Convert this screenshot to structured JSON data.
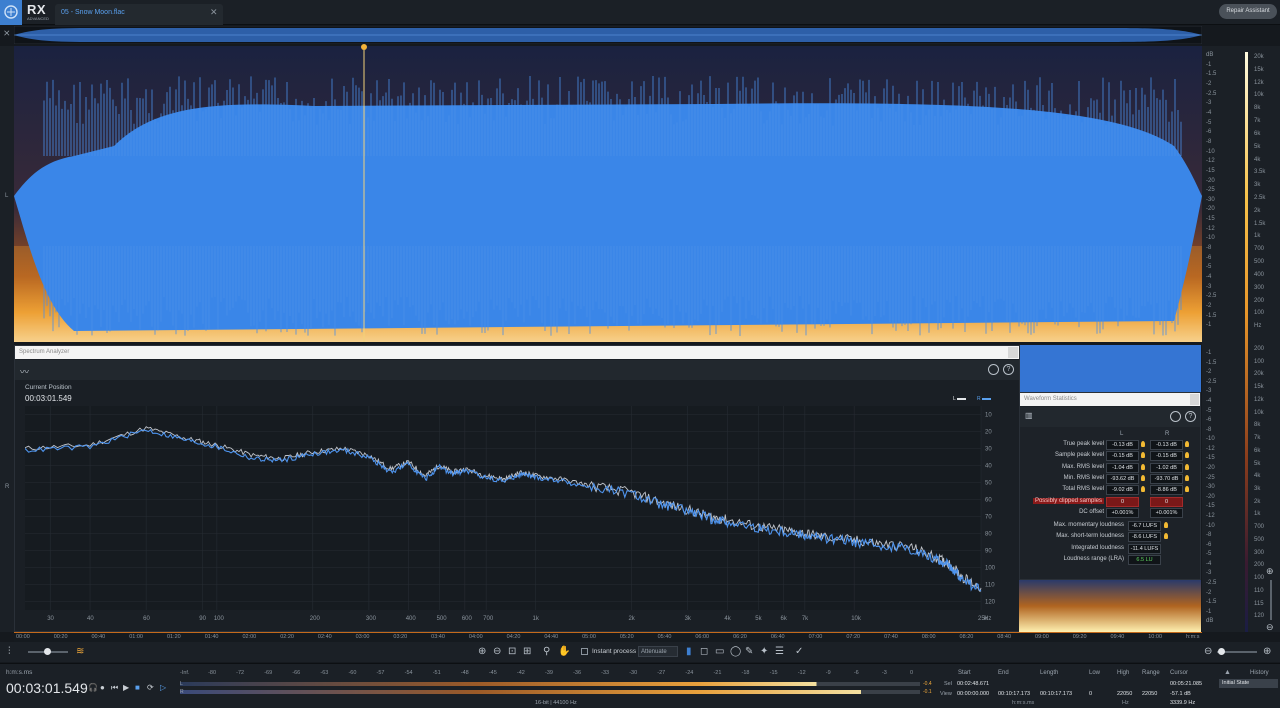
{
  "app": {
    "logo": "RX",
    "logo_sub": "ADVANCED",
    "file_tab": "05 - Snow Moon.flac",
    "repair_assistant": "Repair Assistant"
  },
  "channels": {
    "left": "L",
    "right": "R"
  },
  "db_scale": [
    "dB",
    "-1",
    "-1.5",
    "-2",
    "-2.5",
    "-3",
    "-4",
    "-5",
    "-6",
    "-8",
    "-10",
    "-12",
    "-15",
    "-20",
    "-25",
    "-30",
    "-20",
    "-15",
    "-12",
    "-10",
    "-8",
    "-6",
    "-5",
    "-4",
    "-3",
    "-2.5",
    "-2",
    "-1.5",
    "-1"
  ],
  "hz_scale": [
    "20k",
    "15k",
    "12k",
    "10k",
    "8k",
    "7k",
    "6k",
    "5k",
    "4k",
    "3.5k",
    "3k",
    "2.5k",
    "2k",
    "1.5k",
    "1k",
    "700",
    "500",
    "400",
    "300",
    "200",
    "100",
    "Hz"
  ],
  "db_scale_lower": [
    "-1",
    "-1.5",
    "-2",
    "-2.5",
    "-3",
    "-4",
    "-5",
    "-6",
    "-8",
    "-10",
    "-12",
    "-15",
    "-20",
    "-25",
    "-30",
    "-20",
    "-15",
    "-12",
    "-10",
    "-8",
    "-6",
    "-5",
    "-4",
    "-3",
    "-2.5",
    "-2",
    "-1.5",
    "-1",
    "dB"
  ],
  "hz_scale_lower": [
    "200",
    "100",
    "20k",
    "15k",
    "12k",
    "10k",
    "8k",
    "7k",
    "6k",
    "5k",
    "4k",
    "3k",
    "2k",
    "1k",
    "700",
    "500",
    "300",
    "200",
    "100",
    "110",
    "115",
    "120"
  ],
  "spectrum_analyzer": {
    "title": "Spectrum Analyzer",
    "current_position_label": "Current Position",
    "current_position_time": "00:03:01.549",
    "legend_l": "L",
    "legend_r": "R",
    "help": "?"
  },
  "chart_data": {
    "type": "line",
    "title": "",
    "xlabel": "Hz",
    "ylabel": "dB",
    "x_scale": "log",
    "xlim": [
      25,
      25000
    ],
    "ylim": [
      -125,
      -5
    ],
    "x_tick_labels": [
      "30",
      "40",
      "60",
      "90",
      "100",
      "200",
      "300",
      "400",
      "500",
      "600",
      "700",
      "1k",
      "2k",
      "3k",
      "4k",
      "5k",
      "6k",
      "7k",
      "10k",
      "25k",
      "Hz"
    ],
    "y_tick_labels": [
      "10",
      "20",
      "30",
      "40",
      "50",
      "60",
      "70",
      "80",
      "90",
      "100",
      "110",
      "120"
    ],
    "grid": true,
    "series": [
      {
        "name": "L",
        "x": [
          25,
          40,
          60,
          80,
          100,
          130,
          160,
          200,
          250,
          300,
          350,
          400,
          450,
          500,
          550,
          600,
          700,
          800,
          900,
          1000,
          1200,
          1500,
          2000,
          2500,
          3000,
          3500,
          4000,
          5000,
          6000,
          7000,
          8000,
          10000,
          12000,
          15000,
          18000,
          20000,
          22000,
          25000
        ],
        "y": [
          -30,
          -28,
          -18,
          -24,
          -28,
          -34,
          -36,
          -32,
          -30,
          -34,
          -42,
          -38,
          -46,
          -40,
          -44,
          -42,
          -46,
          -48,
          -44,
          -46,
          -48,
          -52,
          -56,
          -62,
          -66,
          -70,
          -72,
          -76,
          -78,
          -80,
          -82,
          -84,
          -86,
          -88,
          -94,
          -98,
          -106,
          -112
        ]
      },
      {
        "name": "R",
        "x": [
          25,
          40,
          60,
          80,
          100,
          130,
          160,
          200,
          250,
          300,
          350,
          400,
          450,
          500,
          550,
          600,
          700,
          800,
          900,
          1000,
          1200,
          1500,
          2000,
          2500,
          3000,
          3500,
          4000,
          5000,
          6000,
          7000,
          8000,
          10000,
          12000,
          15000,
          18000,
          20000,
          22000,
          25000
        ],
        "y": [
          -31,
          -29,
          -19,
          -25,
          -29,
          -36,
          -37,
          -33,
          -31,
          -35,
          -44,
          -39,
          -48,
          -41,
          -45,
          -43,
          -47,
          -49,
          -45,
          -47,
          -49,
          -53,
          -57,
          -63,
          -67,
          -71,
          -73,
          -77,
          -79,
          -81,
          -83,
          -85,
          -87,
          -89,
          -95,
          -99,
          -107,
          -114
        ]
      }
    ]
  },
  "waveform_statistics": {
    "title": "Waveform Statistics",
    "col_l": "L",
    "col_r": "R",
    "help": "?",
    "rows": [
      {
        "label": "True peak level",
        "l": "-0.13 dB",
        "r": "-0.13 dB"
      },
      {
        "label": "Sample peak level",
        "l": "-0.15 dB",
        "r": "-0.15 dB"
      },
      {
        "label": "Max. RMS level",
        "l": "-1.04 dB",
        "r": "-1.02 dB"
      },
      {
        "label": "Min. RMS level",
        "l": "-93.62 dB",
        "r": "-93.70 dB"
      },
      {
        "label": "Total RMS level",
        "l": "-9.02 dB",
        "r": "-8.86 dB"
      },
      {
        "label": "Possibly clipped samples",
        "l": "0",
        "r": "0"
      },
      {
        "label": "DC offset",
        "l": "+0.001%",
        "r": "+0.001%"
      }
    ],
    "loudness": [
      {
        "label": "Max. momentary loudness",
        "value": "-6.7 LUFS"
      },
      {
        "label": "Max. short-term loudness",
        "value": "-8.6 LUFS"
      },
      {
        "label": "Integrated loudness",
        "value": "-11.4 LUFS"
      },
      {
        "label": "Loudness range (LRA)",
        "value": "6.5 LU"
      }
    ]
  },
  "time_ruler": [
    "00:00",
    "00:20",
    "00:40",
    "01:00",
    "01:20",
    "01:40",
    "02:00",
    "02:20",
    "02:40",
    "03:00",
    "03:20",
    "03:40",
    "04:00",
    "04:20",
    "04:40",
    "05:00",
    "05:20",
    "05:40",
    "06:00",
    "06:20",
    "06:40",
    "07:00",
    "07:20",
    "07:40",
    "08:00",
    "08:20",
    "08:40",
    "09:00",
    "09:20",
    "09:40",
    "10:00",
    "h:m:s"
  ],
  "tools": {
    "instant_process": "Instant process",
    "attenuate": "Attenuate"
  },
  "transport": {
    "format": "h:m:s.ms",
    "time": "00:03:01.549"
  },
  "meter": {
    "ticks": [
      "-Inf.",
      "-80",
      "-72",
      "-69",
      "-66",
      "-63",
      "-60",
      "-57",
      "-54",
      "-51",
      "-48",
      "-45",
      "-42",
      "-39",
      "-36",
      "-33",
      "-30",
      "-27",
      "-24",
      "-21",
      "-18",
      "-15",
      "-12",
      "-9",
      "-6",
      "-3",
      "0"
    ],
    "peak_l": "-0.4",
    "peak_r": "-0.1",
    "l": "L",
    "r": "R",
    "format": "16-bit | 44100 Hz"
  },
  "selection": {
    "start_h": "Start",
    "end_h": "End",
    "length_h": "Length",
    "low_h": "Low",
    "high_h": "High",
    "range_h": "Range",
    "cursor_h": "Cursor",
    "sel_label": "Sel",
    "view_label": "View",
    "sel_start": "00:02:48.671",
    "view_start": "00:00:00.000",
    "view_end": "00:10:17.173",
    "view_length": "00:10:17.173",
    "low": "0",
    "high": "22050",
    "range": "22050",
    "cursor_time": "00:05:21.085",
    "cursor_db": "-57.1 dB",
    "cursor_hz": "3339.9 Hz",
    "time_unit": "h:m:s.ms",
    "hz_unit": "Hz"
  },
  "history": {
    "title": "History",
    "item": "Initial State"
  },
  "colors": {
    "accent": "#3d7fd0",
    "waveform": "#3a86e8",
    "spectrogram_hot": "#f7c24a"
  }
}
